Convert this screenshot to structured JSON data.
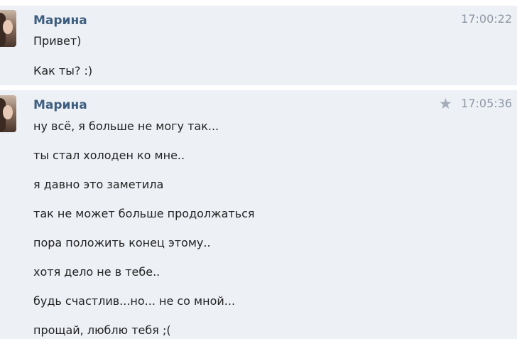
{
  "conversation": {
    "messages": [
      {
        "author": "Марина",
        "time": "17:00:22",
        "starred": false,
        "avatar_icon": "user-photo-avatar",
        "lines": [
          "Привет)",
          "Как ты? :)"
        ]
      },
      {
        "author": "Марина",
        "time": "17:05:36",
        "starred": true,
        "avatar_icon": "user-photo-avatar",
        "star_icon": "star-icon",
        "lines": [
          "ну всё, я больше не могу так...",
          "ты стал холоден ко мне..",
          "я давно это заметила",
          "так не может больше продолжаться",
          "пора положить конец этому..",
          "хотя дело не в тебе..",
          "будь счастлив...но... не со мной...",
          "прощай, люблю тебя ;("
        ]
      }
    ]
  },
  "colors": {
    "message_bg": "#edf0f5",
    "author": "#3e5e7f",
    "time": "#8d96a3",
    "star": "#a3acb8",
    "text": "#222222"
  }
}
